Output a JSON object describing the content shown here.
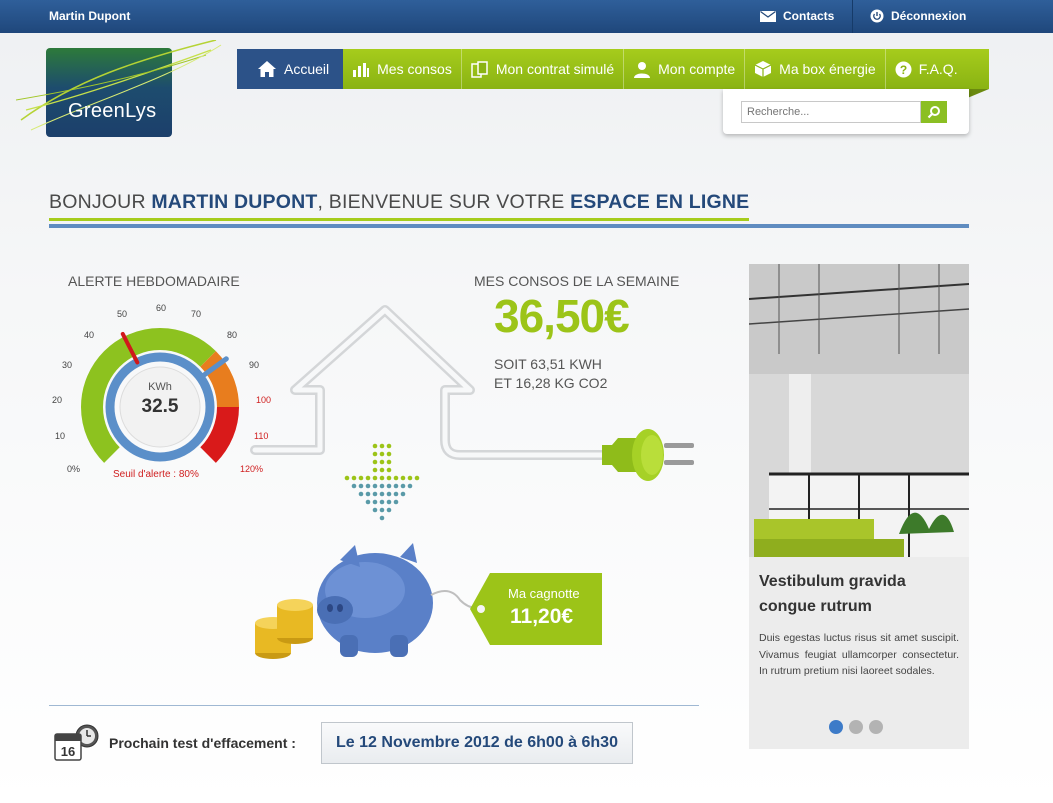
{
  "topbar": {
    "user_name": "Martin Dupont",
    "contacts_label": "Contacts",
    "logout_label": "Déconnexion"
  },
  "logo": {
    "text": "GreenLys"
  },
  "nav": {
    "items": [
      {
        "label": "Accueil",
        "icon": "home-icon",
        "active": true
      },
      {
        "label": "Mes consos",
        "icon": "bar-chart-icon"
      },
      {
        "label": "Mon contrat simulé",
        "icon": "documents-icon"
      },
      {
        "label": "Mon compte",
        "icon": "user-icon"
      },
      {
        "label": "Ma box énergie",
        "icon": "box-icon"
      },
      {
        "label": "F.A.Q.",
        "icon": "help-icon"
      }
    ]
  },
  "search": {
    "placeholder": "Recherche..."
  },
  "welcome": {
    "part1": "BONJOUR ",
    "name": "MARTIN DUPONT",
    "part2": ", BIENVENUE SUR VOTRE ",
    "space": "ESPACE EN LIGNE"
  },
  "gauge": {
    "title": "ALERTE HEBDOMADAIRE",
    "unit": "KWh",
    "value": "32.5",
    "value_percent": 84,
    "threshold_percent": 48,
    "threshold_label": "Seuil d'alerte : 80%",
    "ticks": [
      "0%",
      "10",
      "20",
      "30",
      "40",
      "50",
      "60",
      "70",
      "80",
      "90",
      "100",
      "110",
      "120%"
    ]
  },
  "week": {
    "title": "MES CONSOS DE LA SEMAINE",
    "amount": "36,50€",
    "kwh": "SOIT 63,51 KWH",
    "co2": "ET 16,28 KG CO2"
  },
  "cagnotte": {
    "label": "Ma cagnotte",
    "value": "11,20€"
  },
  "next_test": {
    "label": "Prochain test d'effacement :",
    "date": "Le 12 Novembre 2012 de 6h00 à 6h30",
    "calendar_day": "16"
  },
  "promo": {
    "title": "Vestibulum gravida congue rutrum",
    "text": "Duis egestas luctus risus sit amet suscipit. Vivamus feugiat ullamcorper consectetur. In rutrum pretium nisi laoreet sodales.",
    "slides": 3,
    "active_slide": 0
  },
  "colors": {
    "brand_blue": "#24497a",
    "brand_green": "#9cc418",
    "alert_red": "#d02020"
  }
}
